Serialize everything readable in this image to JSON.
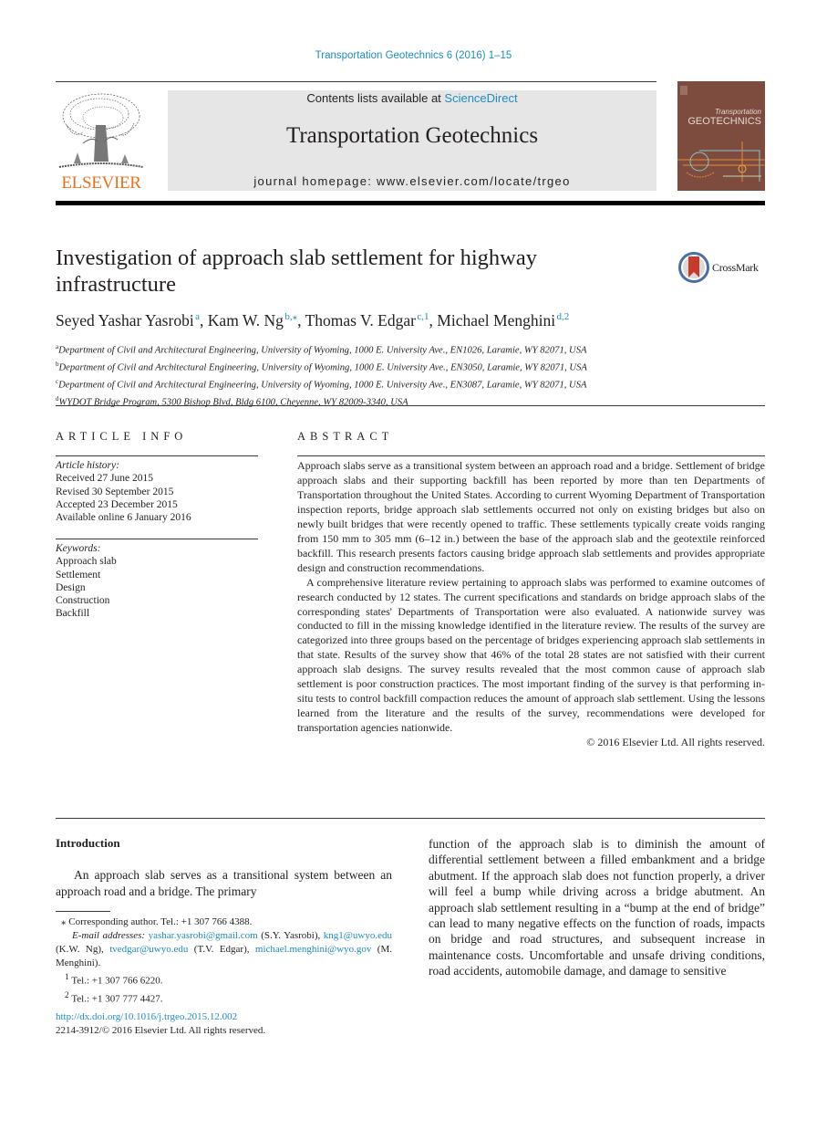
{
  "journal_reference": "Transportation Geotechnics 6 (2016) 1–15",
  "header": {
    "publisher_wordmark": "ELSEVIER",
    "contents_prefix": "Contents lists available at ",
    "contents_link": "ScienceDirect",
    "journal_title": "Transportation Geotechnics",
    "homepage_label": "journal homepage: www.elsevier.com/locate/trgeo",
    "cover_title_small": "Transportation",
    "cover_title_large": "GEOTECHNICS",
    "colors": {
      "link": "#1f8cbf",
      "elsevier_orange": "#e9711c",
      "header_box": "#e6e6e6",
      "cover_brown": "#7d4c3f"
    }
  },
  "article": {
    "title": "Investigation of approach slab settlement for highway infrastructure",
    "crossmark_label": "CrossMark",
    "authors": [
      {
        "name": "Seyed Yashar Yasrobi",
        "sup": "a",
        "sep": ", "
      },
      {
        "name": "Kam W. Ng",
        "sup": "b,⁎",
        "sep": ", "
      },
      {
        "name": "Thomas V. Edgar",
        "sup": "c,1",
        "sep": ", "
      },
      {
        "name": "Michael Menghini",
        "sup": "d,2",
        "sep": ""
      }
    ],
    "affiliations": [
      {
        "key": "a",
        "text": "Department of Civil and Architectural Engineering, University of Wyoming, 1000 E. University Ave., EN1026, Laramie, WY 82071, USA"
      },
      {
        "key": "b",
        "text": "Department of Civil and Architectural Engineering, University of Wyoming, 1000 E. University Ave., EN3050, Laramie, WY 82071, USA"
      },
      {
        "key": "c",
        "text": "Department of Civil and Architectural Engineering, University of Wyoming, 1000 E. University Ave., EN3087, Laramie, WY 82071, USA"
      },
      {
        "key": "d",
        "text": "WYDOT Bridge Program, 5300 Bishop Blvd, Bldg 6100, Cheyenne, WY 82009-3340, USA"
      }
    ]
  },
  "article_info": {
    "heading": "ARTICLE INFO",
    "history_label": "Article history:",
    "history": [
      "Received 27 June 2015",
      "Revised 30 September 2015",
      "Accepted 23 December 2015",
      "Available online 6 January 2016"
    ],
    "keywords_label": "Keywords:",
    "keywords": [
      "Approach slab",
      "Settlement",
      "Design",
      "Construction",
      "Backfill"
    ]
  },
  "abstract": {
    "heading": "ABSTRACT",
    "paragraphs": [
      "Approach slabs serve as a transitional system between an approach road and a bridge. Settlement of bridge approach slabs and their supporting backfill has been reported by more than ten Departments of Transportation throughout the United States. According to current Wyoming Department of Transportation inspection reports, bridge approach slab settlements occurred not only on existing bridges but also on newly built bridges that were recently opened to traffic. These settlements typically create voids ranging from 150 mm to 305 mm (6–12 in.) between the base of the approach slab and the geotextile reinforced backfill. This research presents factors causing bridge approach slab settlements and provides appropriate design and construction recommendations.",
      "A comprehensive literature review pertaining to approach slabs was performed to examine outcomes of research conducted by 12 states. The current specifications and standards on bridge approach slabs of the corresponding states' Departments of Transportation were also evaluated. A nationwide survey was conducted to fill in the missing knowledge identified in the literature review. The results of the survey are categorized into three groups based on the percentage of bridges experiencing approach slab settlements in that state. Results of the survey show that 46% of the total 28 states are not satisfied with their current approach slab designs. The survey results revealed that the most common cause of approach slab settlement is poor construction practices. The most important finding of the survey is that performing in-situ tests to control backfill compaction reduces the amount of approach slab settlement. Using the lessons learned from the literature and the results of the survey, recommendations were developed for transportation agencies nationwide."
    ],
    "copyright": "© 2016 Elsevier Ltd. All rights reserved."
  },
  "introduction": {
    "heading": "Introduction",
    "left_text": "An approach slab serves as a transitional system between an approach road and a bridge. The primary",
    "right_text": "function of the approach slab is to diminish the amount of differential settlement between a filled embankment and a bridge abutment. If the approach slab does not function properly, a driver will feel a bump while driving across a bridge abutment. An approach slab settlement resulting in a “bump at the end of bridge” can lead to many negative effects on the function of roads, impacts on bridge and road structures, and subsequent increase in maintenance costs. Uncomfortable and unsafe driving conditions, road accidents, automobile damage, and damage to sensitive"
  },
  "footnotes": {
    "corresponding": "⁎ Corresponding author. Tel.: +1 307 766 4388.",
    "email_label": "E-mail addresses:",
    "emails": [
      {
        "address": "yashar.yasrobi@gmail.com",
        "who": " (S.Y. Yasrobi), "
      },
      {
        "address": "kng1@uwyo.edu",
        "who": " (K.W. Ng), "
      },
      {
        "address": "tvedgar@uwyo.edu",
        "who": " (T.V. Edgar), "
      },
      {
        "address": "michael.menghini@wyo.gov",
        "who": " (M. Menghini)."
      }
    ],
    "notes": [
      {
        "mark": "1",
        "text": "Tel.: +1 307 766 6220."
      },
      {
        "mark": "2",
        "text": "Tel.: +1 307 777 4427."
      }
    ],
    "doi": "http://dx.doi.org/10.1016/j.trgeo.2015.12.002",
    "issn_line": "2214-3912/© 2016 Elsevier Ltd. All rights reserved."
  }
}
